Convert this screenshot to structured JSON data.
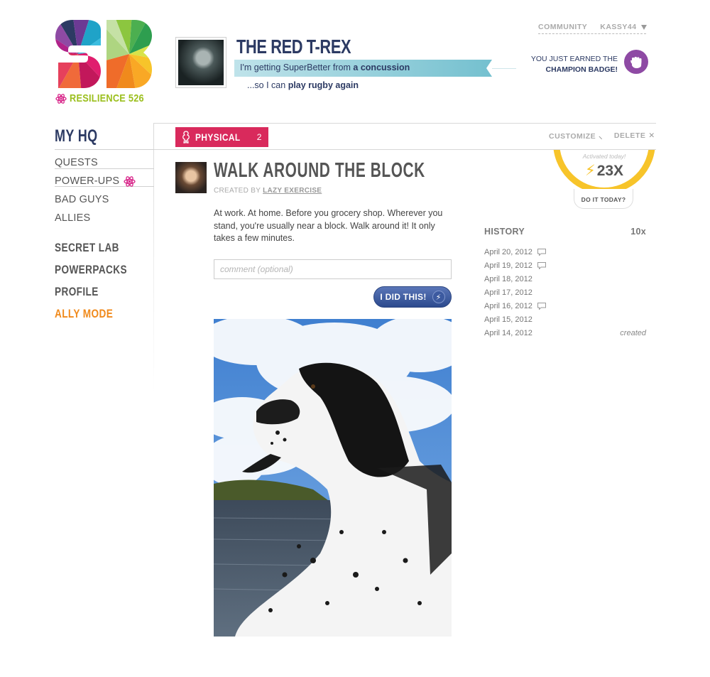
{
  "brand": {
    "logo_text": "SB",
    "resilience_label": "RESILIENCE 526",
    "colors": {
      "green": "#9bbf1d",
      "pink": "#d92a5c",
      "navy": "#2c3a63",
      "orange": "#f08a1c",
      "yellow": "#f7c42a",
      "purple": "#8e4aa4",
      "teal": "#7fc6d3"
    }
  },
  "hero": {
    "name": "THE RED T-REX",
    "ribbon_prefix": "I'm getting SuperBetter from",
    "ribbon_bold": "a concussion",
    "goal_prefix": "...so I can",
    "goal_bold": "play rugby again"
  },
  "topnav": {
    "community": "COMMUNITY",
    "user": "KASSY44"
  },
  "badge": {
    "line1": "YOU JUST EARNED THE",
    "line2": "CHAMPION BADGE!",
    "icon": "fist-icon"
  },
  "sidebar": {
    "title": "MY HQ",
    "items": [
      {
        "label": "QUESTS"
      },
      {
        "label": "POWER-UPS",
        "active": true
      },
      {
        "label": "BAD GUYS"
      },
      {
        "label": "ALLIES"
      }
    ],
    "sections": [
      {
        "label": "SECRET LAB"
      },
      {
        "label": "POWERPACKS"
      },
      {
        "label": "PROFILE"
      },
      {
        "label": "ALLY MODE"
      }
    ]
  },
  "category": {
    "label": "PHYSICAL",
    "count": "2",
    "customize": "CUSTOMIZE",
    "delete": "DELETE"
  },
  "counter": {
    "subtitle": "Activated today!",
    "value": "23X",
    "do_it_today": "DO IT TODAY?"
  },
  "quest": {
    "title": "WALK AROUND THE BLOCK",
    "created_by_label": "CREATED BY",
    "created_by_user": "LAZY EXERCISE",
    "description": "At work. At home. Before you grocery shop. Wherever you stand, you're usually near a block. Walk around it! It only takes a few minutes.",
    "comment_placeholder": "comment (optional)",
    "did_button": "I DID THIS!"
  },
  "history": {
    "title": "HISTORY",
    "count": "10x",
    "entries": [
      {
        "date": "April 20, 2012",
        "comment": true
      },
      {
        "date": "April 19, 2012",
        "comment": true
      },
      {
        "date": "April 18, 2012",
        "comment": false
      },
      {
        "date": "April 17, 2012",
        "comment": false
      },
      {
        "date": "April 16, 2012",
        "comment": true
      },
      {
        "date": "April 15, 2012",
        "comment": false
      },
      {
        "date": "April 14, 2012",
        "comment": false,
        "note": "created"
      }
    ]
  }
}
